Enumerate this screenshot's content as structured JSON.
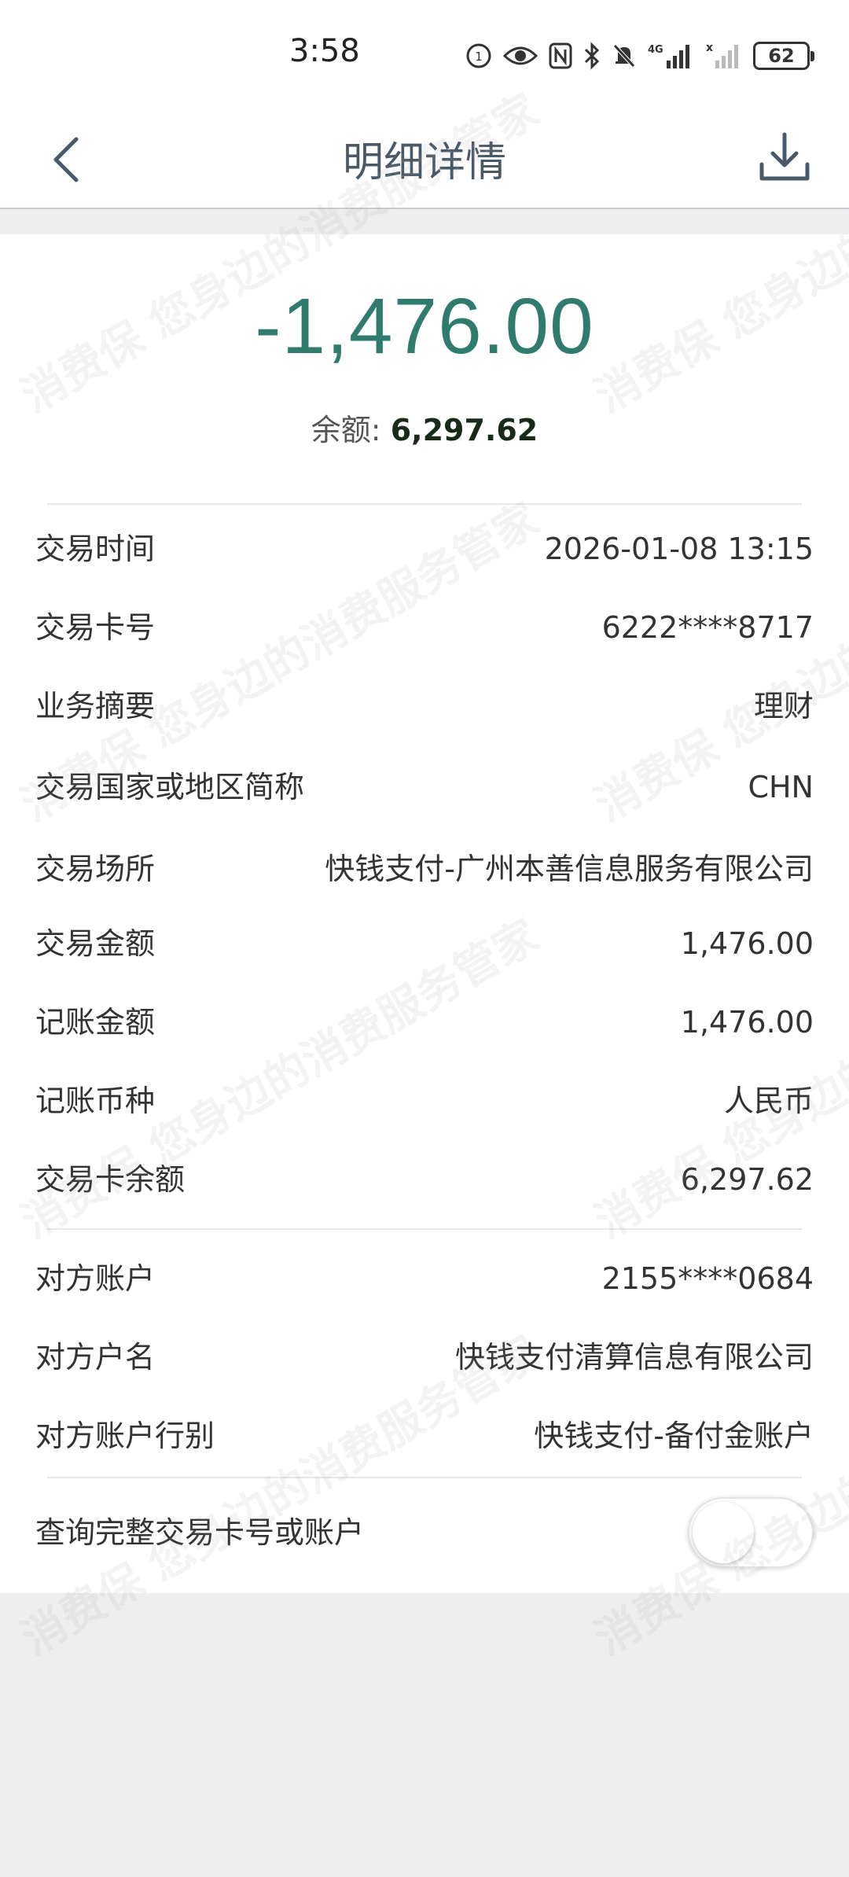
{
  "status_bar": {
    "time": "3:58",
    "network": "4G",
    "battery": "62"
  },
  "header": {
    "title": "明细详情",
    "back_icon": "chevron-left-icon",
    "download_icon": "download-icon"
  },
  "summary": {
    "amount": "-1,476.00",
    "balance_label": "余额:",
    "balance_value": "6,297.62"
  },
  "details": [
    {
      "label": "交易时间",
      "value": "2026-01-08 13:15"
    },
    {
      "label": "交易卡号",
      "value": "6222****8717"
    },
    {
      "label": "业务摘要",
      "value": "理财"
    },
    {
      "label": "交易国家或地区简称",
      "value": "CHN"
    },
    {
      "label": "交易场所",
      "value": "快钱支付-广州本善信息服务有限公司"
    },
    {
      "label": "交易金额",
      "value": "1,476.00"
    },
    {
      "label": "记账金额",
      "value": "1,476.00"
    },
    {
      "label": "记账币种",
      "value": "人民币"
    },
    {
      "label": "交易卡余额",
      "value": "6,297.62"
    }
  ],
  "counterparty": [
    {
      "label": "对方账户",
      "value": "2155****0684"
    },
    {
      "label": "对方户名",
      "value": "快钱支付清算信息有限公司"
    },
    {
      "label": "对方账户行别",
      "value": "快钱支付-备付金账户"
    }
  ],
  "toggle": {
    "label": "查询完整交易卡号或账户",
    "on": false
  },
  "watermark": {
    "text": "消费保 您身边的消费服务管家"
  },
  "colors": {
    "amount": "#2f7b6d",
    "title": "#4a5968",
    "background": "#eeeeee"
  }
}
